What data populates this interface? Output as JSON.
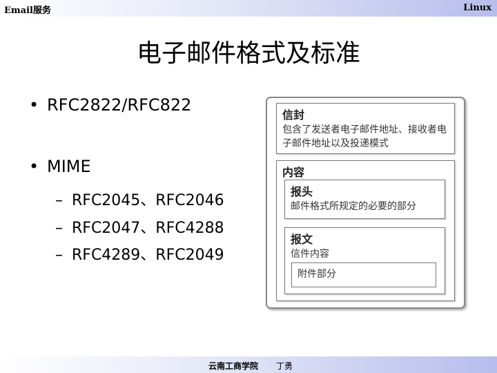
{
  "header": {
    "left": "Email服务",
    "right": "Linux"
  },
  "title": "电子邮件格式及标准",
  "bullets": [
    {
      "marker": "•",
      "text": "RFC2822/RFC822"
    },
    {
      "marker": "•",
      "text": "MIME"
    }
  ],
  "sub_items": [
    {
      "marker": "–",
      "text": "RFC2045、RFC2046"
    },
    {
      "marker": "–",
      "text": "RFC2047、RFC4288"
    },
    {
      "marker": "–",
      "text": "RFC4289、RFC2049"
    }
  ],
  "diagram": {
    "envelope": {
      "head": "信封",
      "body": "包含了发送者电子邮件地址、接收者电子邮件地址以及投递模式"
    },
    "content": {
      "head": "内容",
      "header_part": {
        "head": "报头",
        "body": "邮件格式所规定的必要的部分"
      },
      "message": {
        "head": "报文",
        "body": "信件内容",
        "attachment": "附件部分"
      }
    }
  },
  "footer": {
    "school": "云南工商学院",
    "author": "丁勇"
  }
}
